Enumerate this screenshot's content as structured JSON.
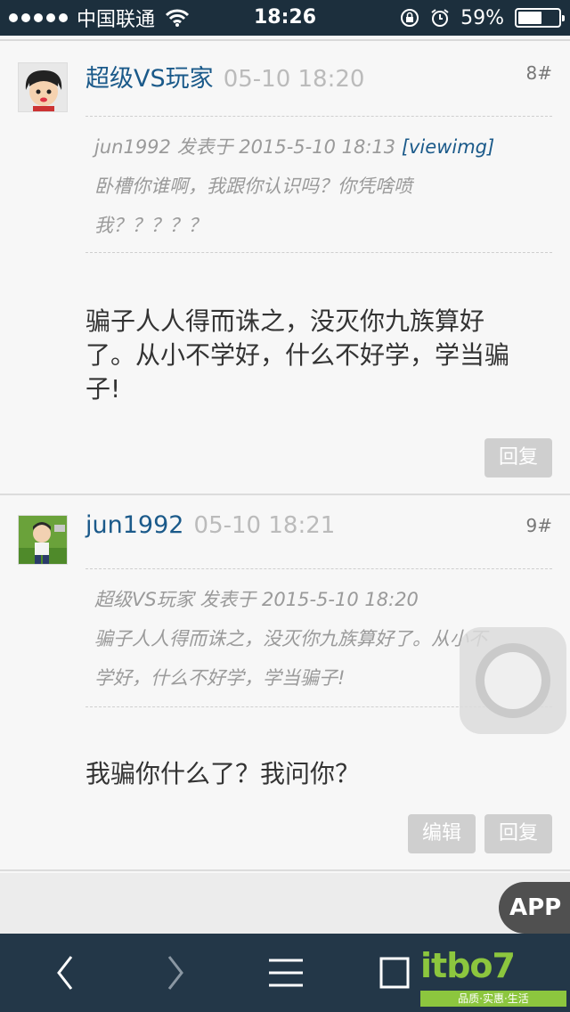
{
  "status_bar": {
    "carrier": "中国联通",
    "time": "18:26",
    "battery_percent": "59%",
    "battery_level": 0.59,
    "icons": [
      "signal-dots-icon",
      "wifi-icon",
      "rotation-lock-icon",
      "alarm-icon",
      "battery-icon"
    ]
  },
  "posts": [
    {
      "author": "超级VS玩家",
      "time": "05-10 18:20",
      "floor": "8#",
      "quote": {
        "header": "jun1992 发表于 2015-5-10 18:13",
        "link": "[viewimg]",
        "line1": "卧槽你谁啊，我跟你认识吗？你凭啥喷",
        "line2": "我？？？？？"
      },
      "content": [
        "骗子人人得而诛之，没灭你九族算好",
        "了。从小不学好，什么不好学，学当骗",
        "子!"
      ],
      "buttons": {
        "reply": "回复"
      }
    },
    {
      "author": "jun1992",
      "time": "05-10 18:21",
      "floor": "9#",
      "quote": {
        "header": "超级VS玩家 发表于 2015-5-10 18:20",
        "line1": "骗子人人得而诛之，没灭你九族算好了。从小不",
        "line2": "学好，什么不好学，学当骗子!"
      },
      "content": [
        "我骗你什么了？我问你？"
      ],
      "buttons": {
        "edit": "编辑",
        "reply": "回复"
      }
    }
  ],
  "app_badge": "APP",
  "toolbar": {
    "icons": [
      "back-icon",
      "forward-icon",
      "menu-icon",
      "tabs-icon"
    ]
  },
  "watermark": {
    "logo_text": "itbo7",
    "tagline": "品质·实惠·生活"
  },
  "colors": {
    "author": "#1b5a8a",
    "status_bar_bg": "#1c2f3d",
    "toolbar_bg": "#233748",
    "button_bg": "#cfcfcf",
    "watermark": "#8cc63e"
  }
}
